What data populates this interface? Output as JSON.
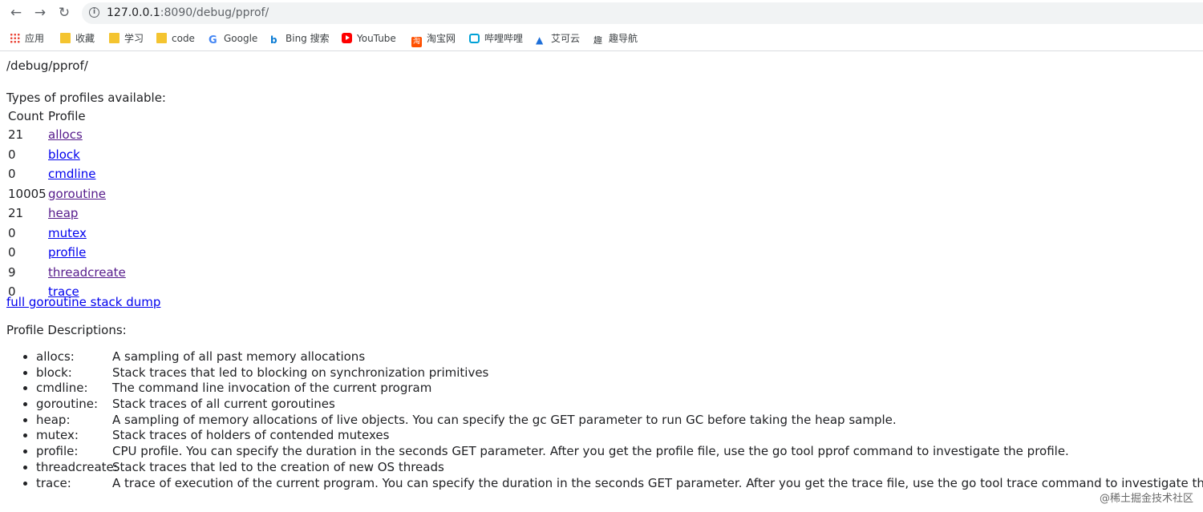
{
  "browser": {
    "url_host": "127.0.0.1",
    "url_rest": ":8090/debug/pprof/",
    "bookmarks": [
      {
        "label": "应用",
        "icon": "apps-grid-icon"
      },
      {
        "label": "收藏",
        "icon": "folder-icon"
      },
      {
        "label": "学习",
        "icon": "folder-icon"
      },
      {
        "label": "code",
        "icon": "folder-icon"
      },
      {
        "label": "Google",
        "icon": "google-icon"
      },
      {
        "label": "Bing 搜索",
        "icon": "bing-icon"
      },
      {
        "label": "YouTube",
        "icon": "youtube-icon"
      },
      {
        "label": "淘宝网",
        "icon": "taobao-icon"
      },
      {
        "label": "哔哩哔哩",
        "icon": "bilibili-icon"
      },
      {
        "label": "艾可云",
        "icon": "cloud-icon"
      },
      {
        "label": "趣导航",
        "icon": "nav-icon"
      }
    ]
  },
  "page": {
    "heading": "/debug/pprof/",
    "types_label": "Types of profiles available:",
    "table_headers": {
      "count": "Count",
      "profile": "Profile"
    },
    "profiles": [
      {
        "count": "21",
        "name": "allocs"
      },
      {
        "count": "0",
        "name": "block"
      },
      {
        "count": "0",
        "name": "cmdline"
      },
      {
        "count": "10005",
        "name": "goroutine"
      },
      {
        "count": "21",
        "name": "heap"
      },
      {
        "count": "0",
        "name": "mutex"
      },
      {
        "count": "0",
        "name": "profile"
      },
      {
        "count": "9",
        "name": "threadcreate"
      },
      {
        "count": "0",
        "name": "trace"
      }
    ],
    "full_dump_link": "full goroutine stack dump",
    "descriptions_label": "Profile Descriptions:",
    "descriptions": [
      {
        "name": "allocs:",
        "text": "A sampling of all past memory allocations"
      },
      {
        "name": "block:",
        "text": "Stack traces that led to blocking on synchronization primitives"
      },
      {
        "name": "cmdline:",
        "text": "The command line invocation of the current program"
      },
      {
        "name": "goroutine:",
        "text": "Stack traces of all current goroutines"
      },
      {
        "name": "heap:",
        "text": "A sampling of memory allocations of live objects. You can specify the gc GET parameter to run GC before taking the heap sample."
      },
      {
        "name": "mutex:",
        "text": "Stack traces of holders of contended mutexes"
      },
      {
        "name": "profile:",
        "text": "CPU profile. You can specify the duration in the seconds GET parameter. After you get the profile file, use the go tool pprof command to investigate the profile."
      },
      {
        "name": "threadcreate:",
        "text": "Stack traces that led to the creation of new OS threads"
      },
      {
        "name": "trace:",
        "text": "A trace of execution of the current program. You can specify the duration in the seconds GET parameter. After you get the trace file, use the go tool trace command to investigate the trace."
      }
    ]
  },
  "watermark": "@稀土掘金技术社区"
}
